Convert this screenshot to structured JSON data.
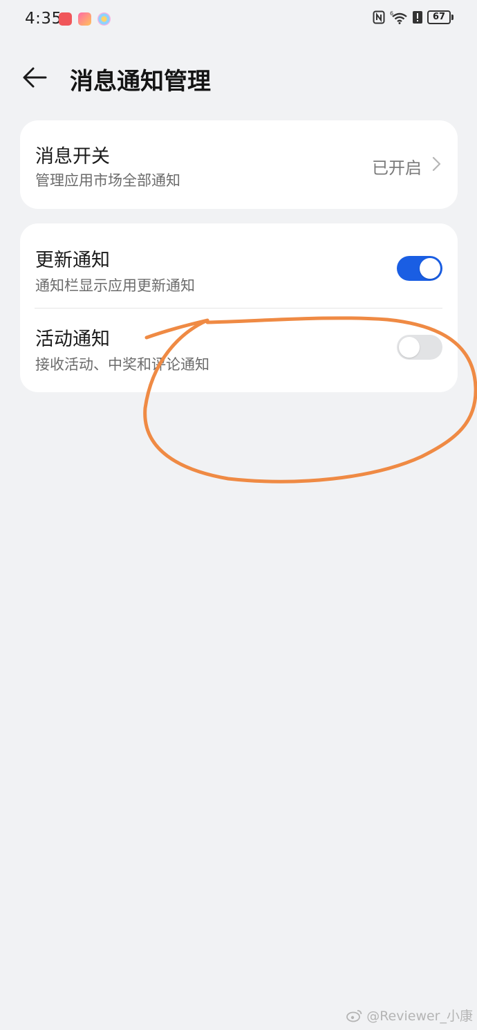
{
  "status_bar": {
    "time": "4:35",
    "battery": "67",
    "icons": [
      "nfc-icon",
      "wifi-icon",
      "alert-icon",
      "battery-icon"
    ]
  },
  "header": {
    "title": "消息通知管理",
    "back_icon": "back-arrow-icon"
  },
  "message_switch": {
    "title": "消息开关",
    "subtitle": "管理应用市场全部通知",
    "status": "已开启"
  },
  "update_notice": {
    "title": "更新通知",
    "subtitle": "通知栏显示应用更新通知",
    "enabled": true
  },
  "activity_notice": {
    "title": "活动通知",
    "subtitle": "接收活动、中奖和评论通知",
    "enabled": false
  },
  "colors": {
    "accent": "#1a5ee3",
    "background": "#f1f2f4",
    "annotation": "#ef8a44"
  },
  "watermark": "@Reviewer_小康"
}
